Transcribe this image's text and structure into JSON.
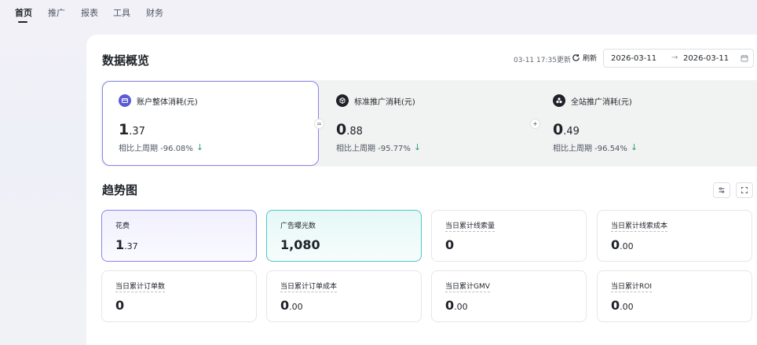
{
  "nav": {
    "items": [
      "首页",
      "推广",
      "报表",
      "工具",
      "财务"
    ],
    "active_index": 0
  },
  "overview": {
    "title": "数据概览",
    "updated_text": "03-11 17:35更新",
    "refresh_label": "刷新",
    "date_start": "2026-03-11",
    "date_arrow": "→",
    "date_end": "2026-03-11",
    "operators": {
      "equals": "=",
      "plus": "+"
    },
    "metrics": [
      {
        "label": "账户整体消耗(元)",
        "int": "1",
        "dec": ".37",
        "compare": "相比上周期 -96.08%",
        "trend": "↓",
        "icon": "wallet-icon",
        "icon_color": "#5b5bd6"
      },
      {
        "label": "标准推广消耗(元)",
        "int": "0",
        "dec": ".88",
        "compare": "相比上周期 -95.77%",
        "trend": "↓",
        "icon": "cube-icon",
        "icon_color": "#1f2329"
      },
      {
        "label": "全站推广消耗(元)",
        "int": "0",
        "dec": ".49",
        "compare": "相比上周期 -96.54%",
        "trend": "↓",
        "icon": "cluster-icon",
        "icon_color": "#1f2329"
      }
    ]
  },
  "trend": {
    "title": "趋势图",
    "cards": [
      {
        "label": "花费",
        "int": "1",
        "dec": ".37",
        "state": "selected-purple"
      },
      {
        "label": "广告曝光数",
        "int": "1,080",
        "dec": "",
        "state": "selected-teal"
      },
      {
        "label": "当日累计线索量",
        "int": "0",
        "dec": "",
        "state": ""
      },
      {
        "label": "当日累计线索成本",
        "int": "0",
        "dec": ".00",
        "state": ""
      },
      {
        "label": "当日累计订单数",
        "int": "0",
        "dec": "",
        "state": ""
      },
      {
        "label": "当日累计订单成本",
        "int": "0",
        "dec": ".00",
        "state": ""
      },
      {
        "label": "当日累计GMV",
        "int": "0",
        "dec": ".00",
        "state": ""
      },
      {
        "label": "当日累计ROI",
        "int": "0",
        "dec": ".00",
        "state": ""
      }
    ]
  },
  "colors": {
    "accent_purple": "#8b84e8",
    "accent_teal": "#4fc7c3",
    "down_green": "#2ea36b"
  }
}
